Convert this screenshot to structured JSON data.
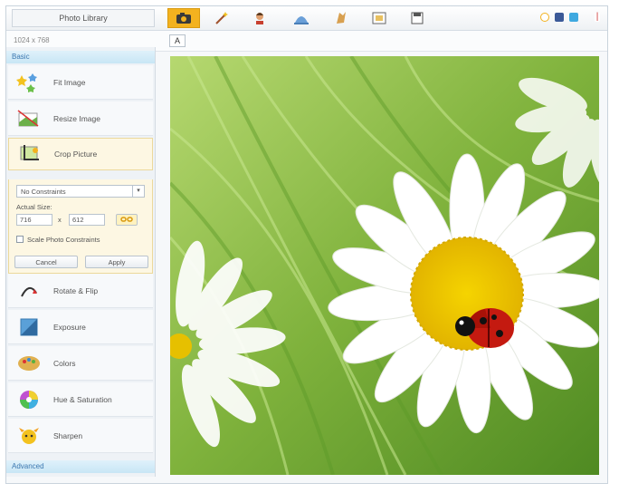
{
  "app": {
    "title": "Photo Library"
  },
  "toolbar": {
    "tools": [
      {
        "icon": "camera-icon"
      },
      {
        "icon": "magic-wand-icon"
      },
      {
        "icon": "portrait-icon"
      },
      {
        "icon": "dome-icon"
      },
      {
        "icon": "frame-icon"
      },
      {
        "icon": "picture-icon"
      },
      {
        "icon": "save-icon"
      }
    ],
    "social_icons": [
      "refresh-icon",
      "facebook-icon",
      "twitter-icon",
      "close-icon"
    ]
  },
  "subtoolbar": {
    "text": "1024 x 768",
    "caret": "A"
  },
  "sidebar": {
    "basic_header": "Basic",
    "advanced_header": "Advanced",
    "items": [
      {
        "label": "Fit Image"
      },
      {
        "label": "Resize Image"
      },
      {
        "label": "Crop Picture"
      },
      {
        "label": "Rotate & Flip"
      },
      {
        "label": "Exposure"
      },
      {
        "label": "Colors"
      },
      {
        "label": "Hue & Saturation"
      },
      {
        "label": "Sharpen"
      }
    ],
    "crop": {
      "preset": "No Constraints",
      "actual_size_label": "Actual Size:",
      "width": "716",
      "times": "x",
      "height": "612",
      "keep_ratio_label": "Scale Photo Constraints",
      "cancel_label": "Cancel",
      "apply_label": "Apply"
    }
  },
  "colors": {
    "accent": "#f3b21f",
    "section": "#3b77b0"
  }
}
